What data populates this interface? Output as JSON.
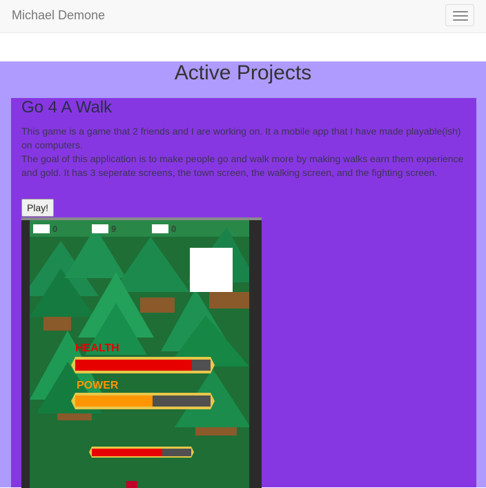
{
  "navbar": {
    "brand": "Michael Demone",
    "menu_icon": "hamburger-icon"
  },
  "section": {
    "title": "Active Projects"
  },
  "project": {
    "title": "Go 4 A Walk",
    "desc_1": "This game is a game that 2 friends and I are working on. It a mobile app that I have made playable(ish) on computers.",
    "desc_2": "The goal of this application is to make people go and walk more by making walks earn them experience and gold. It has 3 seperate screens, the town screen, the walking screen, and the fighting screen.",
    "play_label": "Play!"
  },
  "game": {
    "counters": [
      "0",
      "9",
      "0"
    ],
    "health_label": "HEALTH",
    "power_label": "POWER",
    "health_fraction": 0.86,
    "power_fraction": 0.57,
    "enemy_health_fraction": 0.71
  },
  "colors": {
    "navbar_bg": "#f8f8f8",
    "section_bg": "#ae9bfd",
    "card_bg": "#8737e2",
    "health_red": "#e60000",
    "power_orange": "#ff9500",
    "bar_gold": "#e7c74a"
  }
}
